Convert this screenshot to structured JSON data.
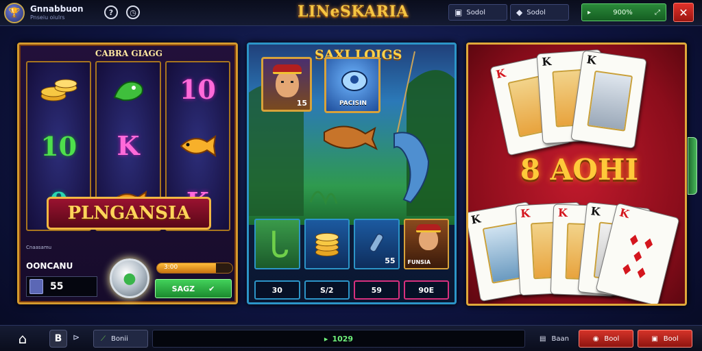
{
  "header": {
    "user_name": "Gnnabbuon",
    "user_sub": "Pnseiu oiulrs",
    "title": "LINeSKARIA",
    "chip1_label": "Sodol",
    "chip2_label": "Sodol",
    "green_value": "900%",
    "close_symbol": "✕"
  },
  "slot": {
    "title": "CABRA GIAGG",
    "symbols": [
      "10",
      "K",
      "10",
      "K",
      "0",
      "K"
    ],
    "banner": "PLNGANSIA",
    "footer_small": "Cnaasamu",
    "label": "OONCANU",
    "bet_value": "55",
    "progress_label": "3:00",
    "progress_fraction": 0.78,
    "green_label": "SAGZ"
  },
  "fishing": {
    "title": "SAXI LOIGS",
    "portrait1_label": "15",
    "pouch_label": "PACISIN",
    "tray_values": [
      "",
      "",
      "55",
      "FUNSIA"
    ],
    "values": [
      "30",
      "S/2",
      "59",
      "90E"
    ]
  },
  "cards": {
    "big_text": "8 AOHI",
    "top_cards": [
      "K",
      "K",
      "K"
    ],
    "bottom_cards": [
      "K",
      "K",
      "K",
      "K",
      "K"
    ]
  },
  "footer": {
    "play_symbol": "⊳",
    "b_label": "B",
    "dark_btn1": "Bonii",
    "center_value": "1029",
    "dark_btn2": "Baan",
    "red_btn1": "Bool",
    "red_btn2": "Bool"
  },
  "colors": {
    "accent_gold": "#f5c542",
    "slot_border": "#d59a2d",
    "fish_border": "#2c95c8",
    "cards_bg": "#c11a2c",
    "green": "#2a8a3a",
    "red": "#d43329"
  },
  "icons": {
    "avatar": "trophy-icon",
    "help": "help-icon",
    "timer": "timer-icon",
    "home": "home-icon",
    "spin": "spin-ball-icon"
  }
}
